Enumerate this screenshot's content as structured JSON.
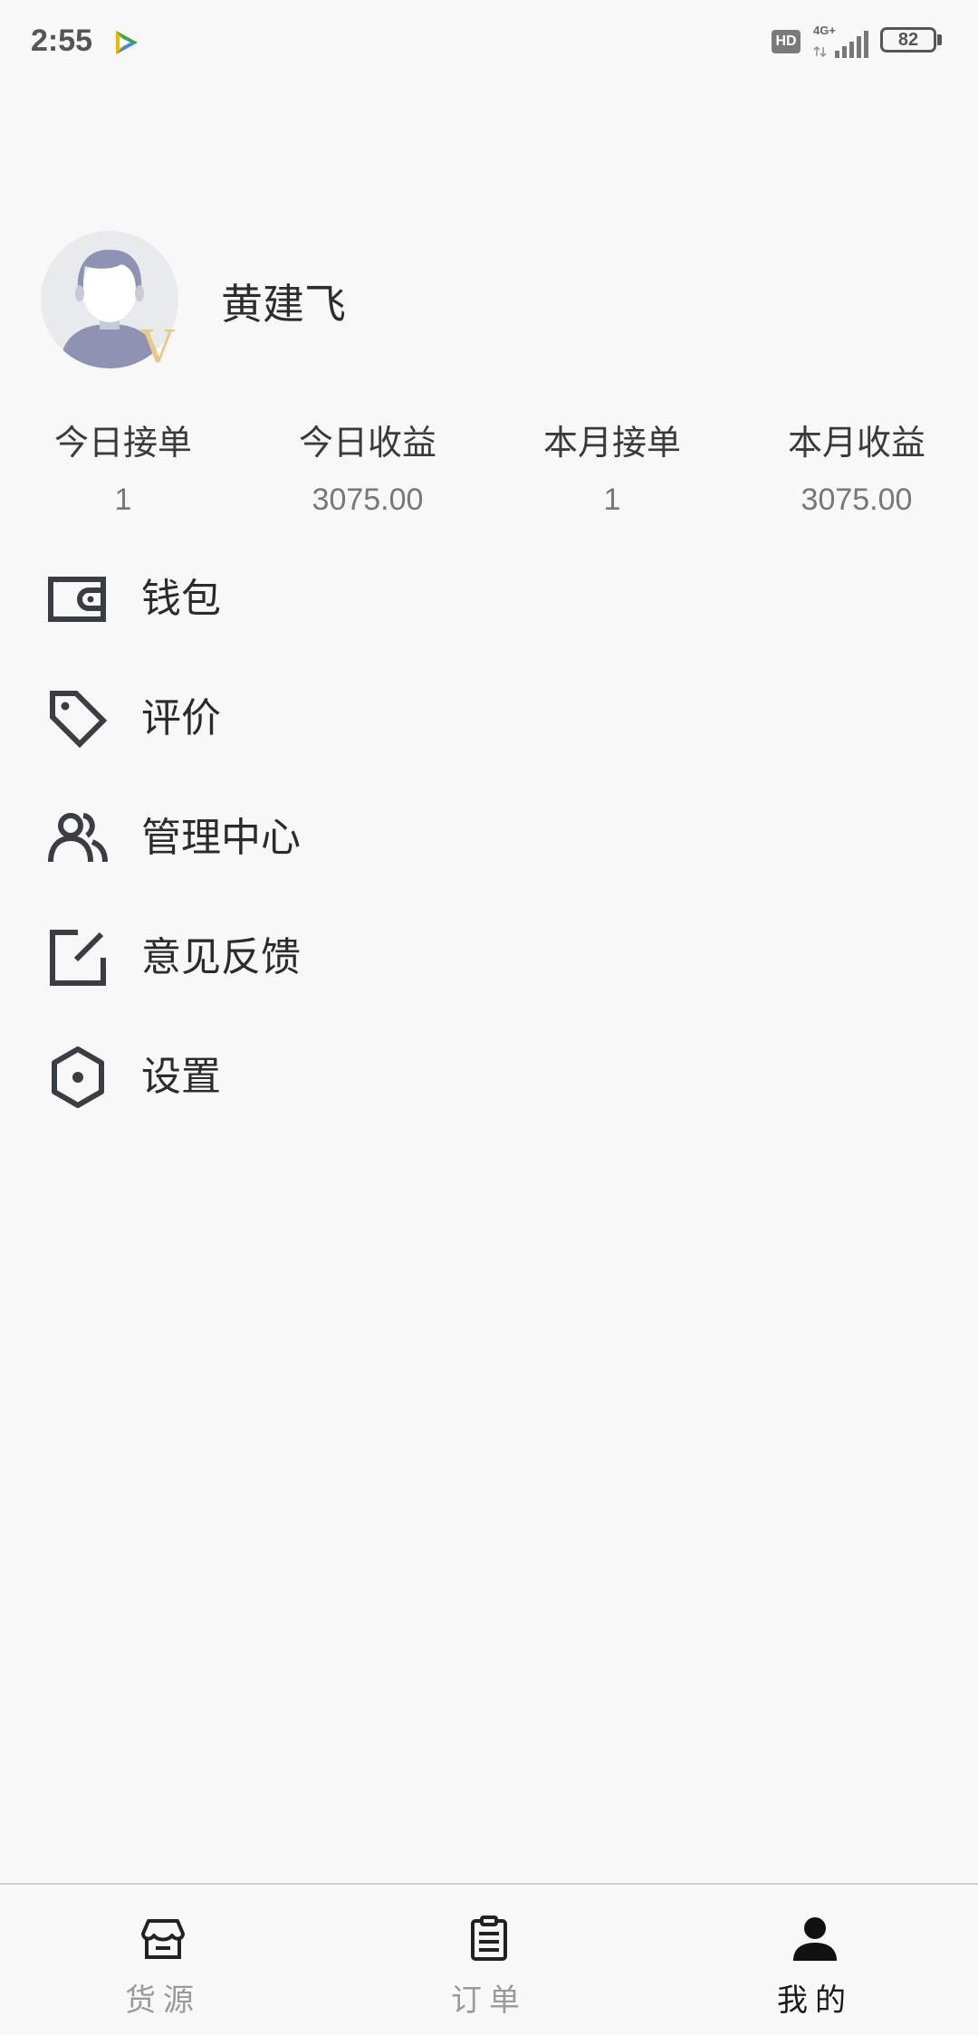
{
  "status_bar": {
    "time": "2:55",
    "hd_label": "HD",
    "network": "4G+",
    "battery": "82"
  },
  "profile": {
    "name": "黄建飞",
    "badge": "V"
  },
  "stats": [
    {
      "label": "今日接单",
      "value": "1"
    },
    {
      "label": "今日收益",
      "value": "3075.00"
    },
    {
      "label": "本月接单",
      "value": "1"
    },
    {
      "label": "本月收益",
      "value": "3075.00"
    }
  ],
  "menu": [
    {
      "label": "钱包",
      "icon": "wallet-icon"
    },
    {
      "label": "评价",
      "icon": "tag-icon"
    },
    {
      "label": "管理中心",
      "icon": "users-icon"
    },
    {
      "label": "意见反馈",
      "icon": "edit-icon"
    },
    {
      "label": "设置",
      "icon": "settings-hexagon-icon"
    }
  ],
  "bottom_nav": [
    {
      "label": "货源",
      "icon": "store-icon",
      "active": false
    },
    {
      "label": "订单",
      "icon": "clipboard-icon",
      "active": false
    },
    {
      "label": "我的",
      "icon": "person-icon",
      "active": true
    }
  ],
  "colors": {
    "background": "#f8f8f8",
    "icon": "#3a3d44",
    "active_nav": "#1a1a1a",
    "inactive_nav": "#9a9a9a",
    "avatar_badge": "#e8c98a"
  }
}
